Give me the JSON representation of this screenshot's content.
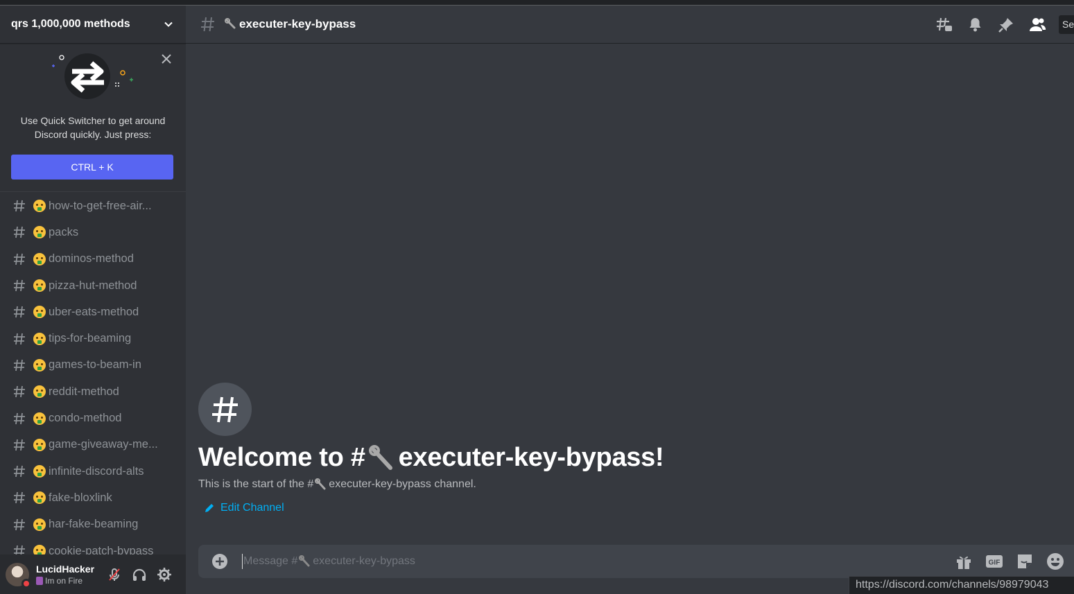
{
  "server": {
    "name": "qrs 1,000,000 methods"
  },
  "quick_switcher": {
    "text": "Use Quick Switcher to get around Discord quickly. Just press:",
    "shortcut": "CTRL + K"
  },
  "channels": [
    {
      "name": "how-to-get-free-air..."
    },
    {
      "name": "packs"
    },
    {
      "name": "dominos-method"
    },
    {
      "name": "pizza-hut-method"
    },
    {
      "name": "uber-eats-method"
    },
    {
      "name": "tips-for-beaming"
    },
    {
      "name": "games-to-beam-in"
    },
    {
      "name": "reddit-method"
    },
    {
      "name": "condo-method"
    },
    {
      "name": "game-giveaway-me..."
    },
    {
      "name": "infinite-discord-alts"
    },
    {
      "name": "fake-bloxlink"
    },
    {
      "name": "har-fake-beaming"
    },
    {
      "name": "cookie-patch-bypass"
    }
  ],
  "user": {
    "name": "LucidHacker",
    "status": "Im on Fire"
  },
  "current_channel": {
    "name": "executer-key-bypass"
  },
  "search": {
    "label": "Se"
  },
  "welcome": {
    "heading_prefix": "Welcome to #",
    "heading_name": "executer-key-bypass!",
    "sub_prefix": "This is the start of the #",
    "sub_suffix": "executer-key-bypass channel.",
    "edit_label": "Edit Channel"
  },
  "composer": {
    "placeholder_prefix": "Message #",
    "placeholder_name": "executer-key-bypass"
  },
  "status_url": "https://discord.com/channels/98979043",
  "colors": {
    "blurple": "#5865f2",
    "link": "#00aff4",
    "bg": "#36393f",
    "sidebar": "#2f3136"
  }
}
